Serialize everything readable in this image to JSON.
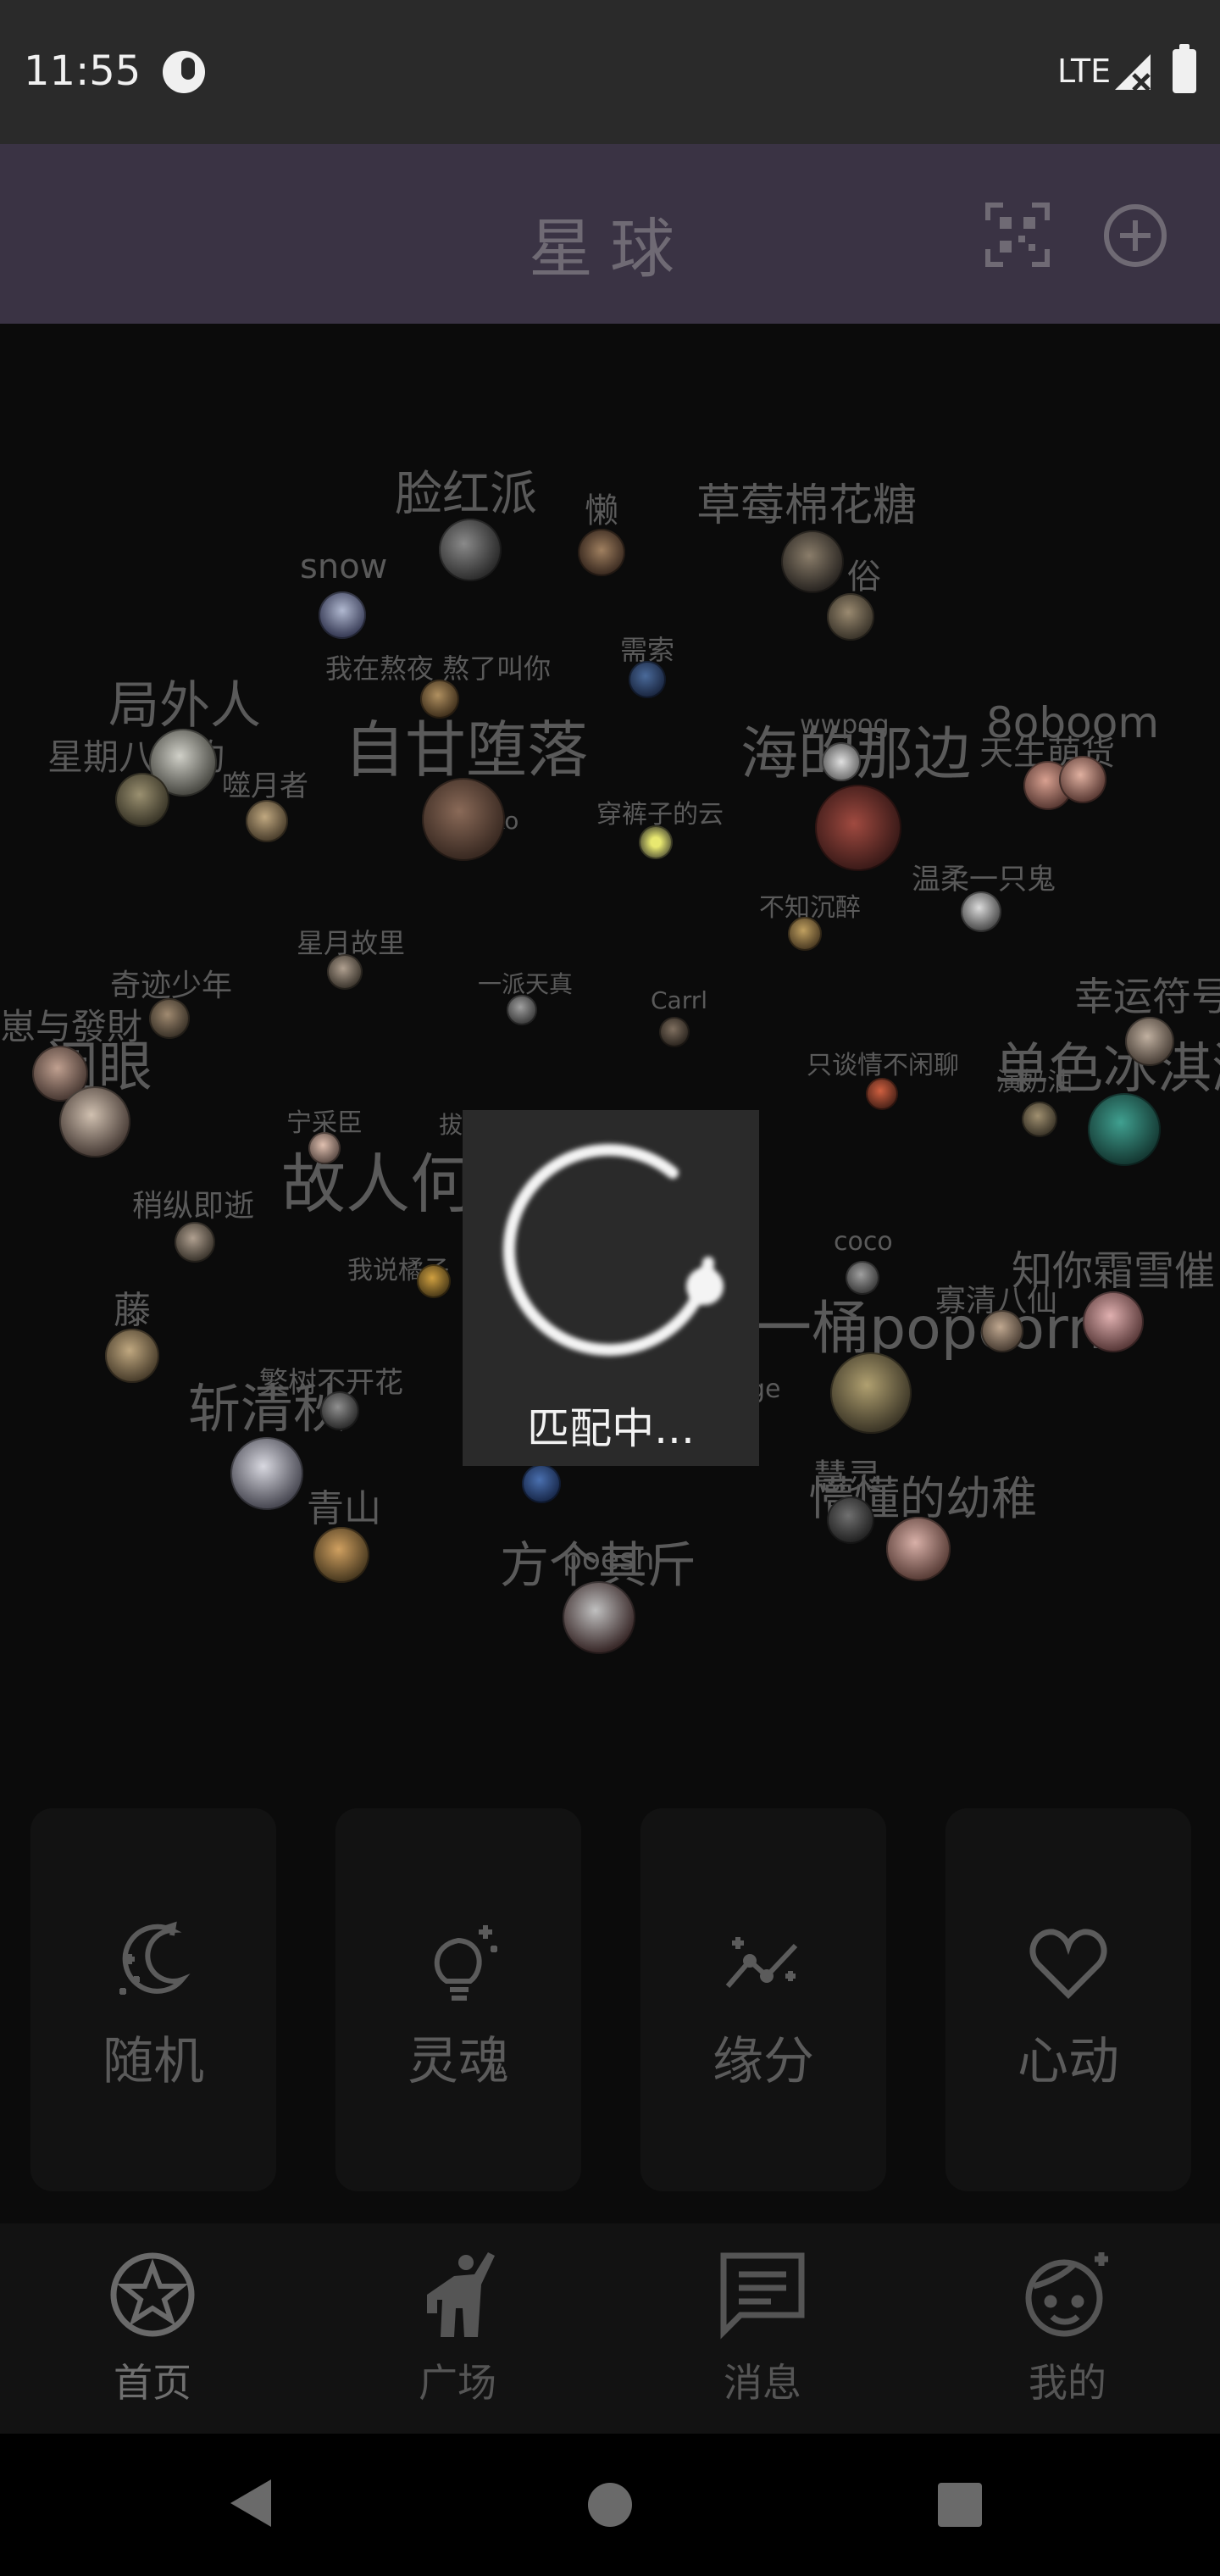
{
  "status_bar": {
    "time": "11:55",
    "network": "LTE"
  },
  "header": {
    "title": "星球"
  },
  "planet": {
    "nicknames": [
      "脸红派",
      "懒",
      "草莓棉花糖",
      "snow",
      "俗",
      "我在熬夜 熬了叫你",
      "需索",
      "局外人",
      "星期八的约",
      "自甘堕落",
      "海的那边",
      "8oboom",
      "天生萌货",
      "噬月者",
      "ko",
      "穿裤子的云",
      "wwpog",
      "温柔一只鬼",
      "不知沉醉",
      "星月故里",
      "奇迹少年",
      "崽与發財",
      "闭眼",
      "一派天真",
      "Carrl",
      "幸运符号",
      "单色冰淇淋",
      "只谈情不闲聊",
      "演奶油",
      "宁采臣",
      "拔",
      "故人何",
      "稍纵即逝",
      "我说橘子",
      "coco",
      "知你霜雪催",
      "一桶popcorn",
      "寡清八仙",
      "藤",
      "斩清秋",
      "繁树不开花",
      "ge",
      "青山",
      "慧灵",
      "懵懂的幼稚",
      "方个其斤",
      "poesh"
    ]
  },
  "loading": {
    "text": "匹配中..."
  },
  "cards": [
    {
      "label": "随机",
      "icon": "random-moon-icon"
    },
    {
      "label": "灵魂",
      "icon": "soul-bulb-icon"
    },
    {
      "label": "缘分",
      "icon": "fate-trend-icon"
    },
    {
      "label": "心动",
      "icon": "heart-icon"
    }
  ],
  "bottom_nav": [
    {
      "label": "首页",
      "icon": "star-home-icon",
      "active": true
    },
    {
      "label": "广场",
      "icon": "square-person-icon",
      "active": false
    },
    {
      "label": "消息",
      "icon": "message-icon",
      "active": false
    },
    {
      "label": "我的",
      "icon": "profile-face-icon",
      "active": false
    }
  ]
}
